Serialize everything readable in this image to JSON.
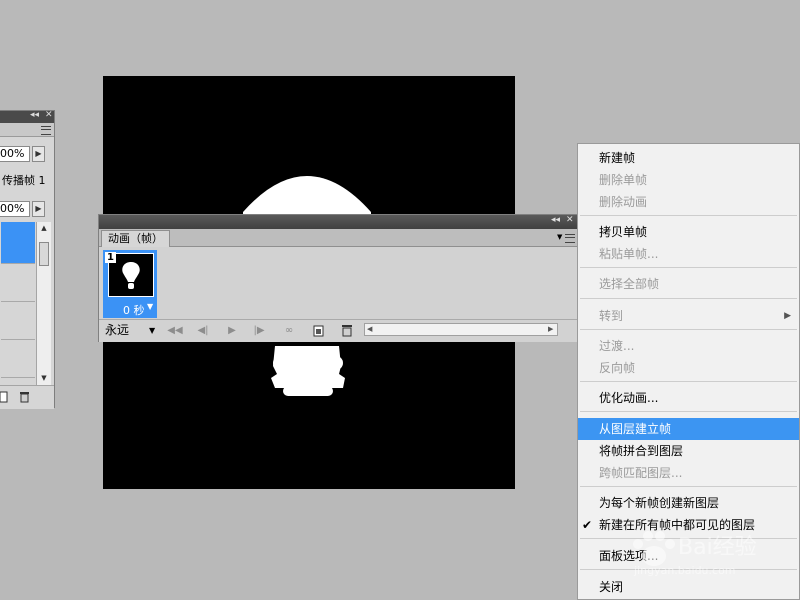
{
  "layers_panel": {
    "opacity_value": "00%",
    "fill_value": "00%",
    "spread_label": "传播帧 1"
  },
  "animation_panel": {
    "tab_label": "动画（帧）",
    "frame_number": "1",
    "frame_delay": "0 秒",
    "loop_option": "永远"
  },
  "context_menu": {
    "items": [
      {
        "label": "新建帧",
        "enabled": true
      },
      {
        "label": "删除单帧",
        "enabled": false
      },
      {
        "label": "删除动画",
        "enabled": false
      },
      {
        "label": "拷贝单帧",
        "enabled": true
      },
      {
        "label": "粘贴单帧...",
        "enabled": false
      },
      {
        "label": "选择全部帧",
        "enabled": false
      },
      {
        "label": "转到",
        "enabled": false,
        "submenu": true
      },
      {
        "label": "过渡...",
        "enabled": false
      },
      {
        "label": "反向帧",
        "enabled": false
      },
      {
        "label": "优化动画...",
        "enabled": true
      },
      {
        "label": "从图层建立帧",
        "enabled": true,
        "highlighted": true
      },
      {
        "label": "将帧拼合到图层",
        "enabled": true
      },
      {
        "label": "跨帧匹配图层...",
        "enabled": false
      },
      {
        "label": "为每个新帧创建新图层",
        "enabled": true
      },
      {
        "label": "新建在所有帧中都可见的图层",
        "enabled": true,
        "checked": true
      },
      {
        "label": "面板选项...",
        "enabled": true
      },
      {
        "label": "关闭",
        "enabled": true
      }
    ]
  },
  "watermark": {
    "text": "Bai经验",
    "url": "jingyan.baidu.com"
  },
  "colors": {
    "workspace": "#b9b9b9",
    "selection": "#3b92f5",
    "menu_bg": "#f1f1f1"
  }
}
